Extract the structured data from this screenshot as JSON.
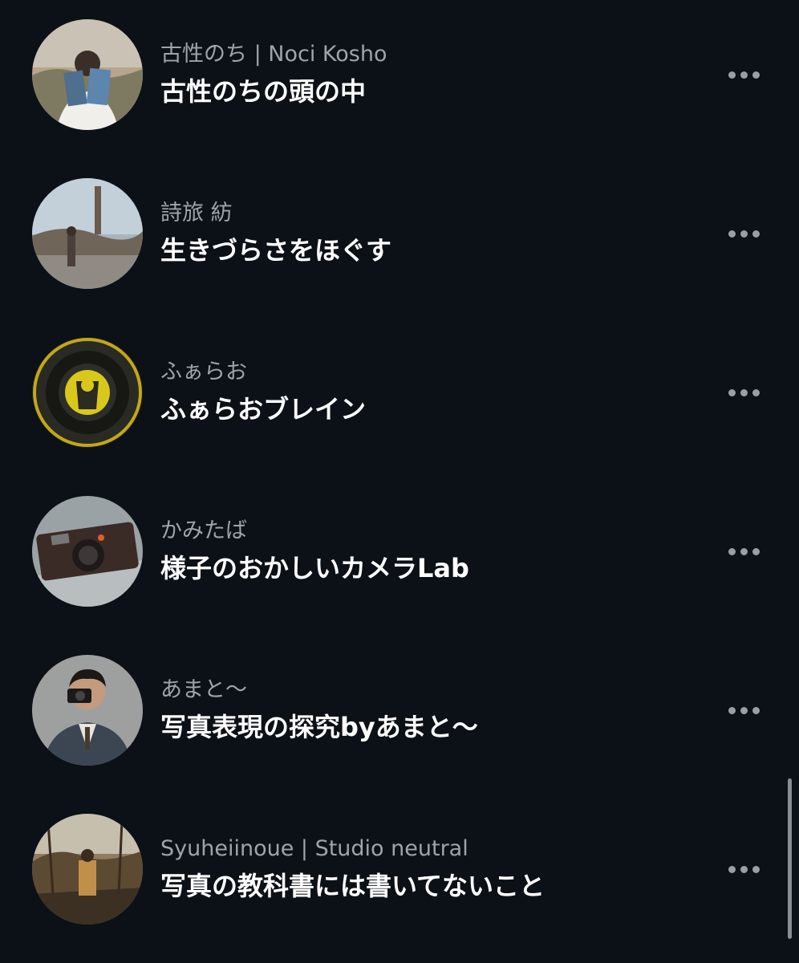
{
  "items": [
    {
      "author": "古性のち | Noci Kosho",
      "title": "古性のちの頭の中",
      "avatar_icon": "person-reading-magazine-photo"
    },
    {
      "author": "詩旅 紡",
      "title": "生きづらさをほぐす",
      "avatar_icon": "person-in-park-tower-photo"
    },
    {
      "author": "ふぁらお",
      "title": "ふぁらおブレイン",
      "avatar_icon": "camera-lens-pharaoh-photo"
    },
    {
      "author": "かみたば",
      "title": "様子のおかしいカメラLab",
      "avatar_icon": "leica-camera-photo"
    },
    {
      "author": "あまと〜",
      "title": "写真表現の探究byあまと〜",
      "avatar_icon": "man-with-camera-photo"
    },
    {
      "author": "Syuheiinoue | Studio neutral",
      "title": "写真の教科書には書いてないこと",
      "avatar_icon": "person-in-forest-photo"
    }
  ],
  "more_icon": "ellipsis-icon",
  "colors": {
    "background": "#0b1117",
    "author_text": "#a0a4a8",
    "title_text": "#ffffff",
    "more_dots": "#9b9fa4"
  }
}
